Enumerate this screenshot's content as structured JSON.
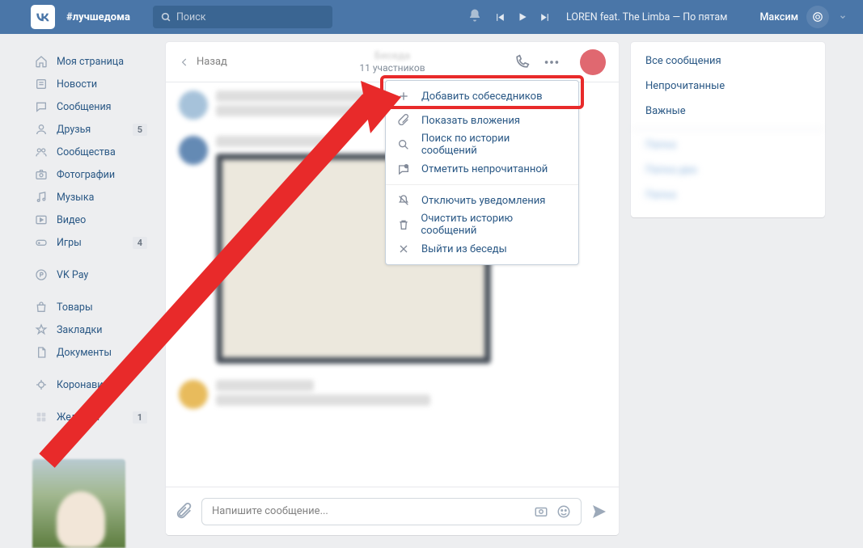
{
  "header": {
    "hashtag": "#лучшедома",
    "search_placeholder": "Поиск",
    "now_playing": "LOREN feat. The Limba — По пятам",
    "username": "Максим"
  },
  "sidebar": {
    "items": [
      {
        "label": "Моя страница",
        "icon": "home"
      },
      {
        "label": "Новости",
        "icon": "newspaper"
      },
      {
        "label": "Сообщения",
        "icon": "chat"
      },
      {
        "label": "Друзья",
        "icon": "user",
        "badge": "5"
      },
      {
        "label": "Сообщества",
        "icon": "users"
      },
      {
        "label": "Фотографии",
        "icon": "camera"
      },
      {
        "label": "Музыка",
        "icon": "music"
      },
      {
        "label": "Видео",
        "icon": "video"
      },
      {
        "label": "Игры",
        "icon": "gamepad",
        "badge": "4"
      }
    ],
    "extra": [
      {
        "label": "VK Pay",
        "icon": "pay"
      }
    ],
    "more": [
      {
        "label": "Товары",
        "icon": "bag"
      },
      {
        "label": "Закладки",
        "icon": "star"
      },
      {
        "label": "Документы",
        "icon": "doc"
      }
    ],
    "last": [
      {
        "label": "Коронавирус",
        "icon": "virus"
      }
    ],
    "wishes": {
      "label": "Желания",
      "badge": "1"
    }
  },
  "chat": {
    "back": "Назад",
    "subtitle": "11 участников"
  },
  "dropdown": {
    "items": [
      {
        "label": "Добавить собеседников",
        "icon": "plus"
      },
      {
        "label": "Показать вложения",
        "icon": "attach"
      },
      {
        "label": "Поиск по истории сообщений",
        "icon": "search"
      },
      {
        "label": "Отметить непрочитанной",
        "icon": "unread"
      },
      {
        "label": "Отключить уведомления",
        "icon": "bell-off"
      },
      {
        "label": "Очистить историю сообщений",
        "icon": "trash"
      },
      {
        "label": "Выйти из беседы",
        "icon": "close"
      }
    ]
  },
  "compose": {
    "placeholder": "Напишите сообщение..."
  },
  "filters": {
    "all": "Все сообщения",
    "unread": "Непрочитанные",
    "important": "Важные"
  }
}
